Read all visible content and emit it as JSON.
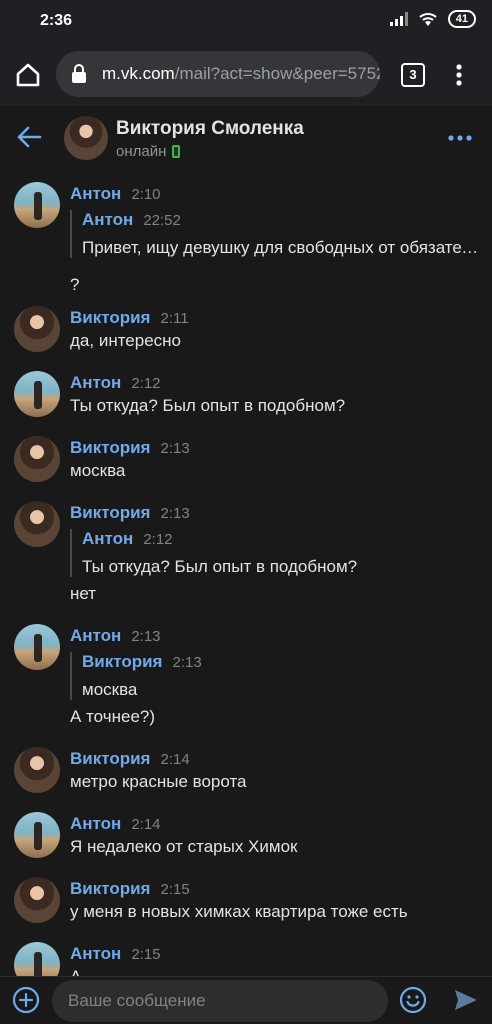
{
  "status_bar": {
    "time": "2:36",
    "battery": "41"
  },
  "browser": {
    "url_host": "m.vk.com",
    "url_rest": "/mail?act=show&peer=5752",
    "tab_count": "3"
  },
  "chat": {
    "name": "Виктория Смоленка",
    "status": "онлайн"
  },
  "messages": [
    {
      "author": "Антон",
      "time": "2:10",
      "forward": {
        "author": "Антон",
        "time": "22:52",
        "text": "Привет, ищу девушку для свободных от обязательств отношений"
      },
      "text": "?"
    },
    {
      "author": "Виктория",
      "time": "2:11",
      "text": "да, интересно"
    },
    {
      "author": "Антон",
      "time": "2:12",
      "text": "Ты откуда? Был опыт в подобном?"
    },
    {
      "author": "Виктория",
      "time": "2:13",
      "text": "москва"
    },
    {
      "author": "Виктория",
      "time": "2:13",
      "forward": {
        "author": "Антон",
        "time": "2:12",
        "text": "Ты откуда? Был опыт в подобном?"
      },
      "text": "нет"
    },
    {
      "author": "Антон",
      "time": "2:13",
      "forward": {
        "author": "Виктория",
        "time": "2:13",
        "text": "москва"
      },
      "text": "А точнее?)"
    },
    {
      "author": "Виктория",
      "time": "2:14",
      "text": "метро красные ворота"
    },
    {
      "author": "Антон",
      "time": "2:14",
      "text": "Я недалеко от старых Химок"
    },
    {
      "author": "Виктория",
      "time": "2:15",
      "text": "у меня в новых химках квартира тоже есть"
    },
    {
      "author": "Антон",
      "time": "2:15",
      "text": "А"
    }
  ],
  "composer": {
    "placeholder": "Ваше сообщение"
  }
}
